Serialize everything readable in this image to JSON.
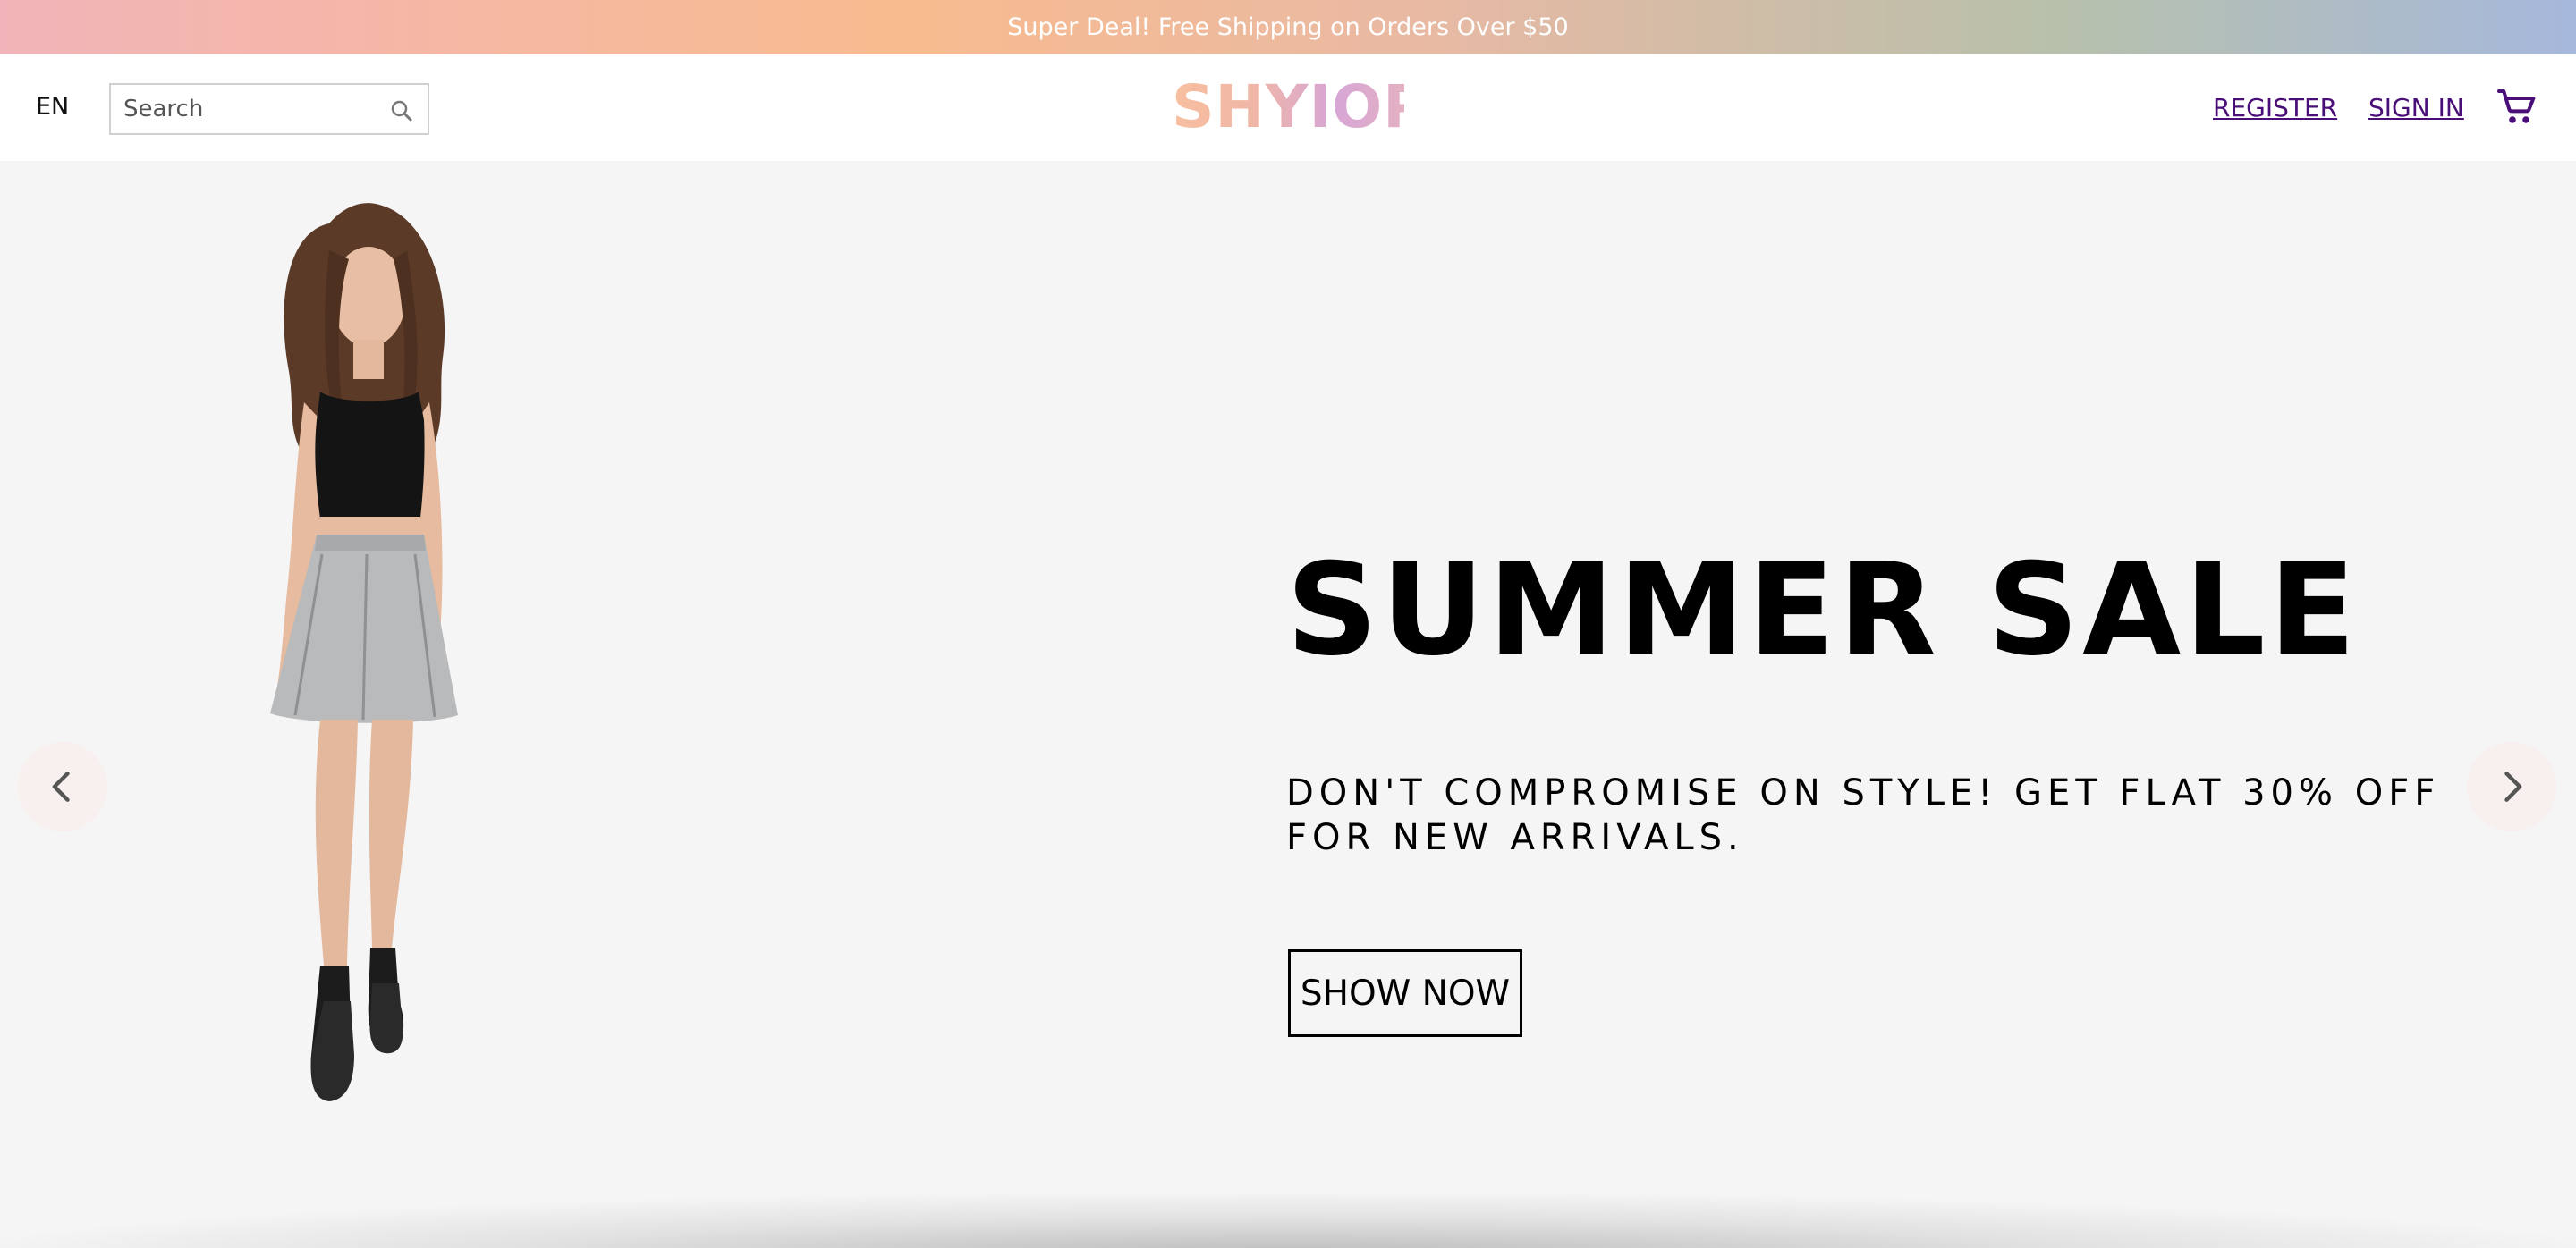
{
  "announcement": {
    "text": "Super Deal! Free Shipping on Orders Over $50"
  },
  "header": {
    "language": "EN",
    "search": {
      "placeholder": "Search",
      "value": ""
    },
    "logo": "SHYIOP",
    "register_label": "REGISTER",
    "signin_label": "SIGN IN",
    "icons": [
      "search-icon",
      "cart-icon"
    ]
  },
  "hero": {
    "title": "SUMMER SALE",
    "description": "DON'T COMPROMISE ON STYLE! GET FLAT 30% OFF FOR NEW ARRIVALS.",
    "cta_label": "SHOW NOW",
    "background_color": "#f5f5f5",
    "icons": [
      "chevron-left-icon",
      "chevron-right-icon"
    ]
  },
  "colors": {
    "link": "#4a0e78",
    "text": "#000000"
  }
}
